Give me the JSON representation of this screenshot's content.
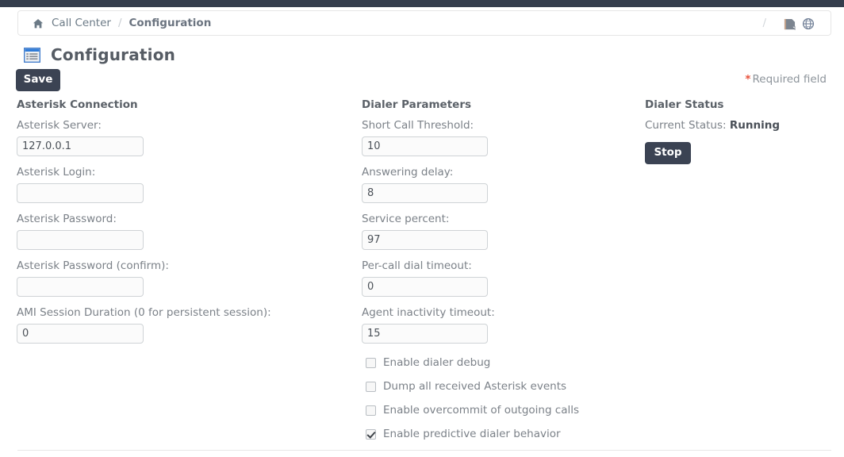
{
  "topbar": {
    "present": true,
    "color": "#343d4c"
  },
  "breadcrumb": {
    "home_icon": "home-icon",
    "parent_label": "Call Center",
    "separator": "/",
    "current_label": "Configuration",
    "right_separator": "/",
    "page_icon": "page-icon",
    "globe_icon": "globe-icon"
  },
  "header": {
    "icon": "list-report-icon",
    "title": "Configuration"
  },
  "toolbar": {
    "save_label": "Save"
  },
  "required_note": {
    "star": "*",
    "text": "Required field",
    "star_color": "#e8503a"
  },
  "asterisk_connection": {
    "title": "Asterisk Connection",
    "fields": [
      {
        "label": "Asterisk Server:",
        "value": "127.0.0.1",
        "type": "text",
        "placeholder": ""
      },
      {
        "label": "Asterisk Login:",
        "value": "",
        "type": "text",
        "placeholder": ""
      },
      {
        "label": "Asterisk Password:",
        "value": "",
        "type": "password",
        "placeholder": ""
      },
      {
        "label": "Asterisk Password (confirm):",
        "value": "",
        "type": "password",
        "placeholder": ""
      },
      {
        "label": "AMI Session Duration (0 for persistent session):",
        "value": "0",
        "type": "text",
        "placeholder": ""
      }
    ]
  },
  "dialer_parameters": {
    "title": "Dialer Parameters",
    "fields": [
      {
        "label": "Short Call Threshold:",
        "value": "10",
        "type": "text",
        "placeholder": ""
      },
      {
        "label": "Answering delay:",
        "value": "8",
        "type": "text",
        "placeholder": ""
      },
      {
        "label": "Service percent:",
        "value": "97",
        "type": "text",
        "placeholder": ""
      },
      {
        "label": "Per-call dial timeout:",
        "value": "0",
        "type": "text",
        "placeholder": ""
      },
      {
        "label": "Agent inactivity timeout:",
        "value": "15",
        "type": "text",
        "placeholder": ""
      }
    ],
    "checkboxes": [
      {
        "label": "Enable dialer debug",
        "checked": false
      },
      {
        "label": "Dump all received Asterisk events",
        "checked": false
      },
      {
        "label": "Enable overcommit of outgoing calls",
        "checked": false
      },
      {
        "label": "Enable predictive dialer behavior",
        "checked": true
      }
    ]
  },
  "dialer_status": {
    "title": "Dialer Status",
    "status_label": "Current Status:",
    "status_value": "Running",
    "action_label": "Stop"
  }
}
